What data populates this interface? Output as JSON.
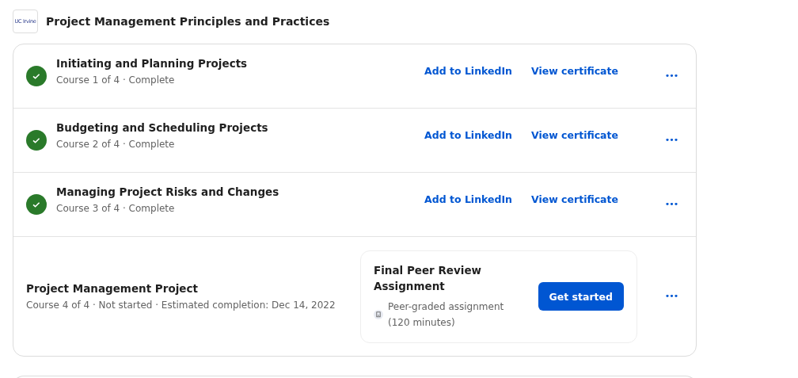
{
  "header": {
    "logo_text": "UC Irvine",
    "title": "Project Management Principles and Practices"
  },
  "courses": [
    {
      "kind": "complete",
      "completed": true,
      "title": "Initiating and Planning Projects",
      "meta": "Course 1 of 4 · Complete",
      "actions": [
        "Add to LinkedIn",
        "View certificate"
      ],
      "menu": "•••"
    },
    {
      "kind": "complete",
      "completed": true,
      "title": "Budgeting and Scheduling Projects",
      "meta": "Course 2 of 4 · Complete",
      "actions": [
        "Add to LinkedIn",
        "View certificate"
      ],
      "menu": "•••"
    },
    {
      "kind": "complete",
      "completed": true,
      "title": "Managing Project Risks and Changes",
      "meta": "Course 3 of 4 · Complete",
      "actions": [
        "Add to LinkedIn",
        "View certificate"
      ],
      "menu": "•••"
    },
    {
      "kind": "project",
      "completed": false,
      "title": "Project Management Project",
      "meta": "Course 4 of 4 · Not started · Estimated completion: Dec 14, 2022",
      "next": {
        "title": "Final Peer Review Assignment",
        "detail": "Peer-graded assignment (120 minutes)",
        "button": "Get started"
      },
      "menu": "•••"
    }
  ]
}
